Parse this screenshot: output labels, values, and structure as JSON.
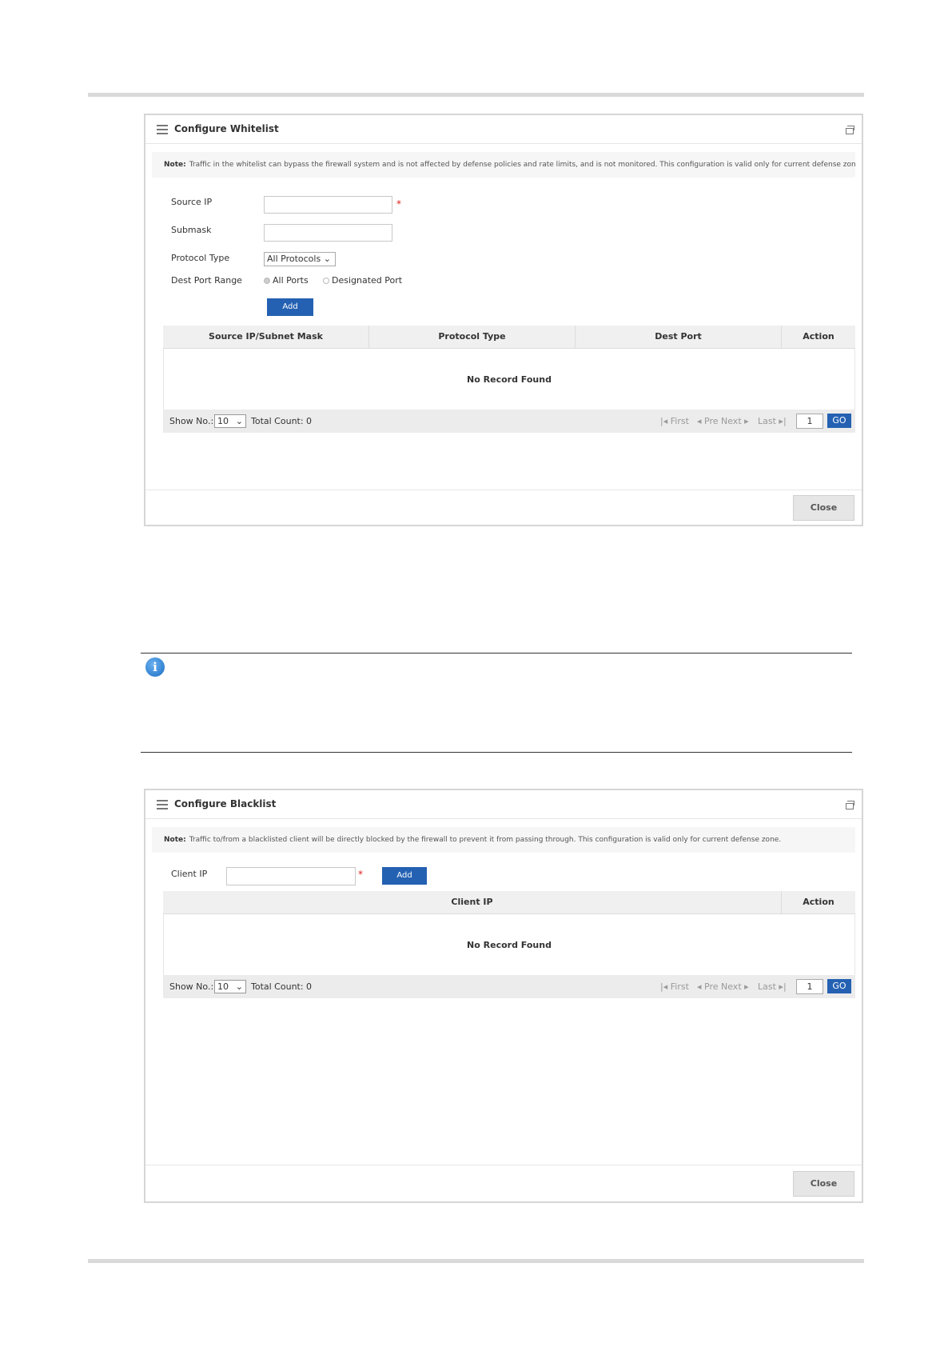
{
  "whitelist": {
    "title": "Configure Whitelist",
    "note_label": "Note:",
    "note_text": "Traffic in the whitelist can bypass the firewall system and is not affected by defense policies and rate limits, and is not monitored. This configuration is valid only for current defense zone.",
    "source_ip_label": "Source IP",
    "source_ip_value": "",
    "submask_label": "Submask",
    "submask_value": "",
    "protocol_type_label": "Protocol Type",
    "protocol_selected": "All Protocols",
    "dest_port_label": "Dest Port Range",
    "radio_all_ports": "All Ports",
    "radio_designated_port": "Designated Port",
    "add_label": "Add",
    "columns": [
      "Source IP/Subnet Mask",
      "Protocol Type",
      "Dest Port",
      "Action"
    ],
    "no_record": "No Record Found",
    "show_no_label": "Show No.:",
    "show_no_value": "10",
    "total_count": "Total Count: 0",
    "pager": {
      "first": "First",
      "pre": "Pre",
      "next": "Next",
      "last": "Last"
    },
    "page_value": "1",
    "go_label": "GO",
    "close_label": "Close"
  },
  "info_icon": "info-icon",
  "blacklist": {
    "title": "Configure Blacklist",
    "note_label": "Note:",
    "note_text": "Traffic to/from a blacklisted client will be directly blocked by the firewall to prevent it from passing through. This configuration is valid only for current defense zone.",
    "client_ip_label": "Client IP",
    "client_ip_value": "",
    "add_label": "Add",
    "columns": [
      "Client IP",
      "Action"
    ],
    "no_record": "No Record Found",
    "show_no_label": "Show No.:",
    "show_no_value": "10",
    "total_count": "Total Count: 0",
    "pager": {
      "first": "First",
      "pre": "Pre",
      "next": "Next",
      "last": "Last"
    },
    "page_value": "1",
    "go_label": "GO",
    "close_label": "Close"
  }
}
